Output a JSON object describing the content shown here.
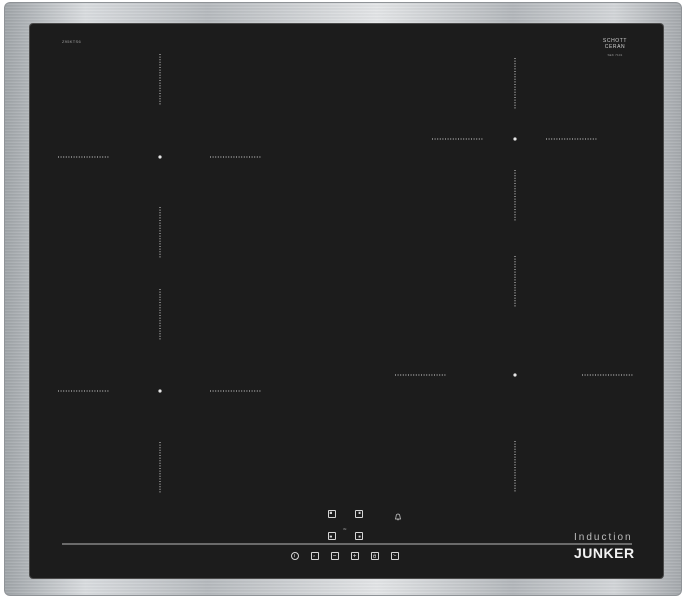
{
  "cooktop": {
    "model_code": "Z95KTS6",
    "glass_brand": "SCHOTT",
    "glass_brand_line2": "CERAN",
    "glass_brand_sub": "SEK 7101",
    "type_label": "Induction",
    "brand": "JUNKER",
    "control_small_label": "rfc",
    "colors": {
      "glass": "#1c1c1c",
      "frame": "#c9ccd0",
      "markings": "#d8d8d8",
      "brand_text": "#f2f2f2"
    }
  },
  "controls": {
    "top_row": [
      "zone-select-top-left-icon",
      "zone-select-top-right-icon"
    ],
    "bottom_row": [
      "zone-select-bottom-left-icon",
      "zone-select-bottom-right-icon"
    ],
    "timer_alarm": "bell-icon",
    "panel": [
      "power-icon",
      "powerboost-icon",
      "minus-icon",
      "plus-icon",
      "lock-icon",
      "timer-icon"
    ]
  }
}
